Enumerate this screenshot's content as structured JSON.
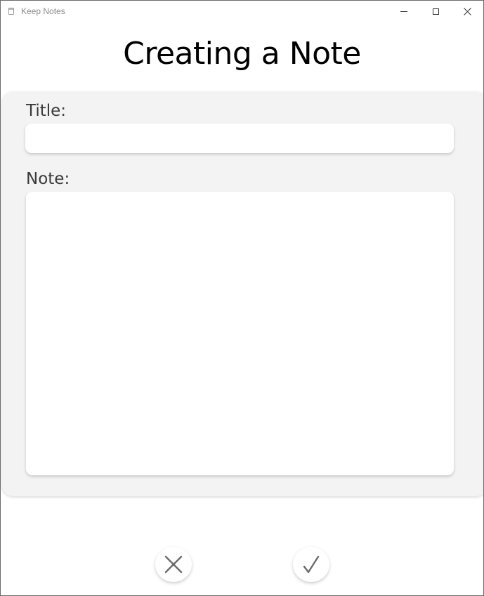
{
  "window": {
    "title": "Keep Notes",
    "icons": {
      "app": "notepad-icon",
      "minimize": "minimize-icon",
      "maximize": "maximize-icon",
      "close": "close-icon"
    }
  },
  "page": {
    "heading": "Creating a Note"
  },
  "form": {
    "title_label": "Title:",
    "title_value": "",
    "note_label": "Note:",
    "note_value": ""
  },
  "actions": {
    "cancel_icon": "x-icon",
    "confirm_icon": "checkmark-icon",
    "icon_color": "#6b6b6b"
  }
}
